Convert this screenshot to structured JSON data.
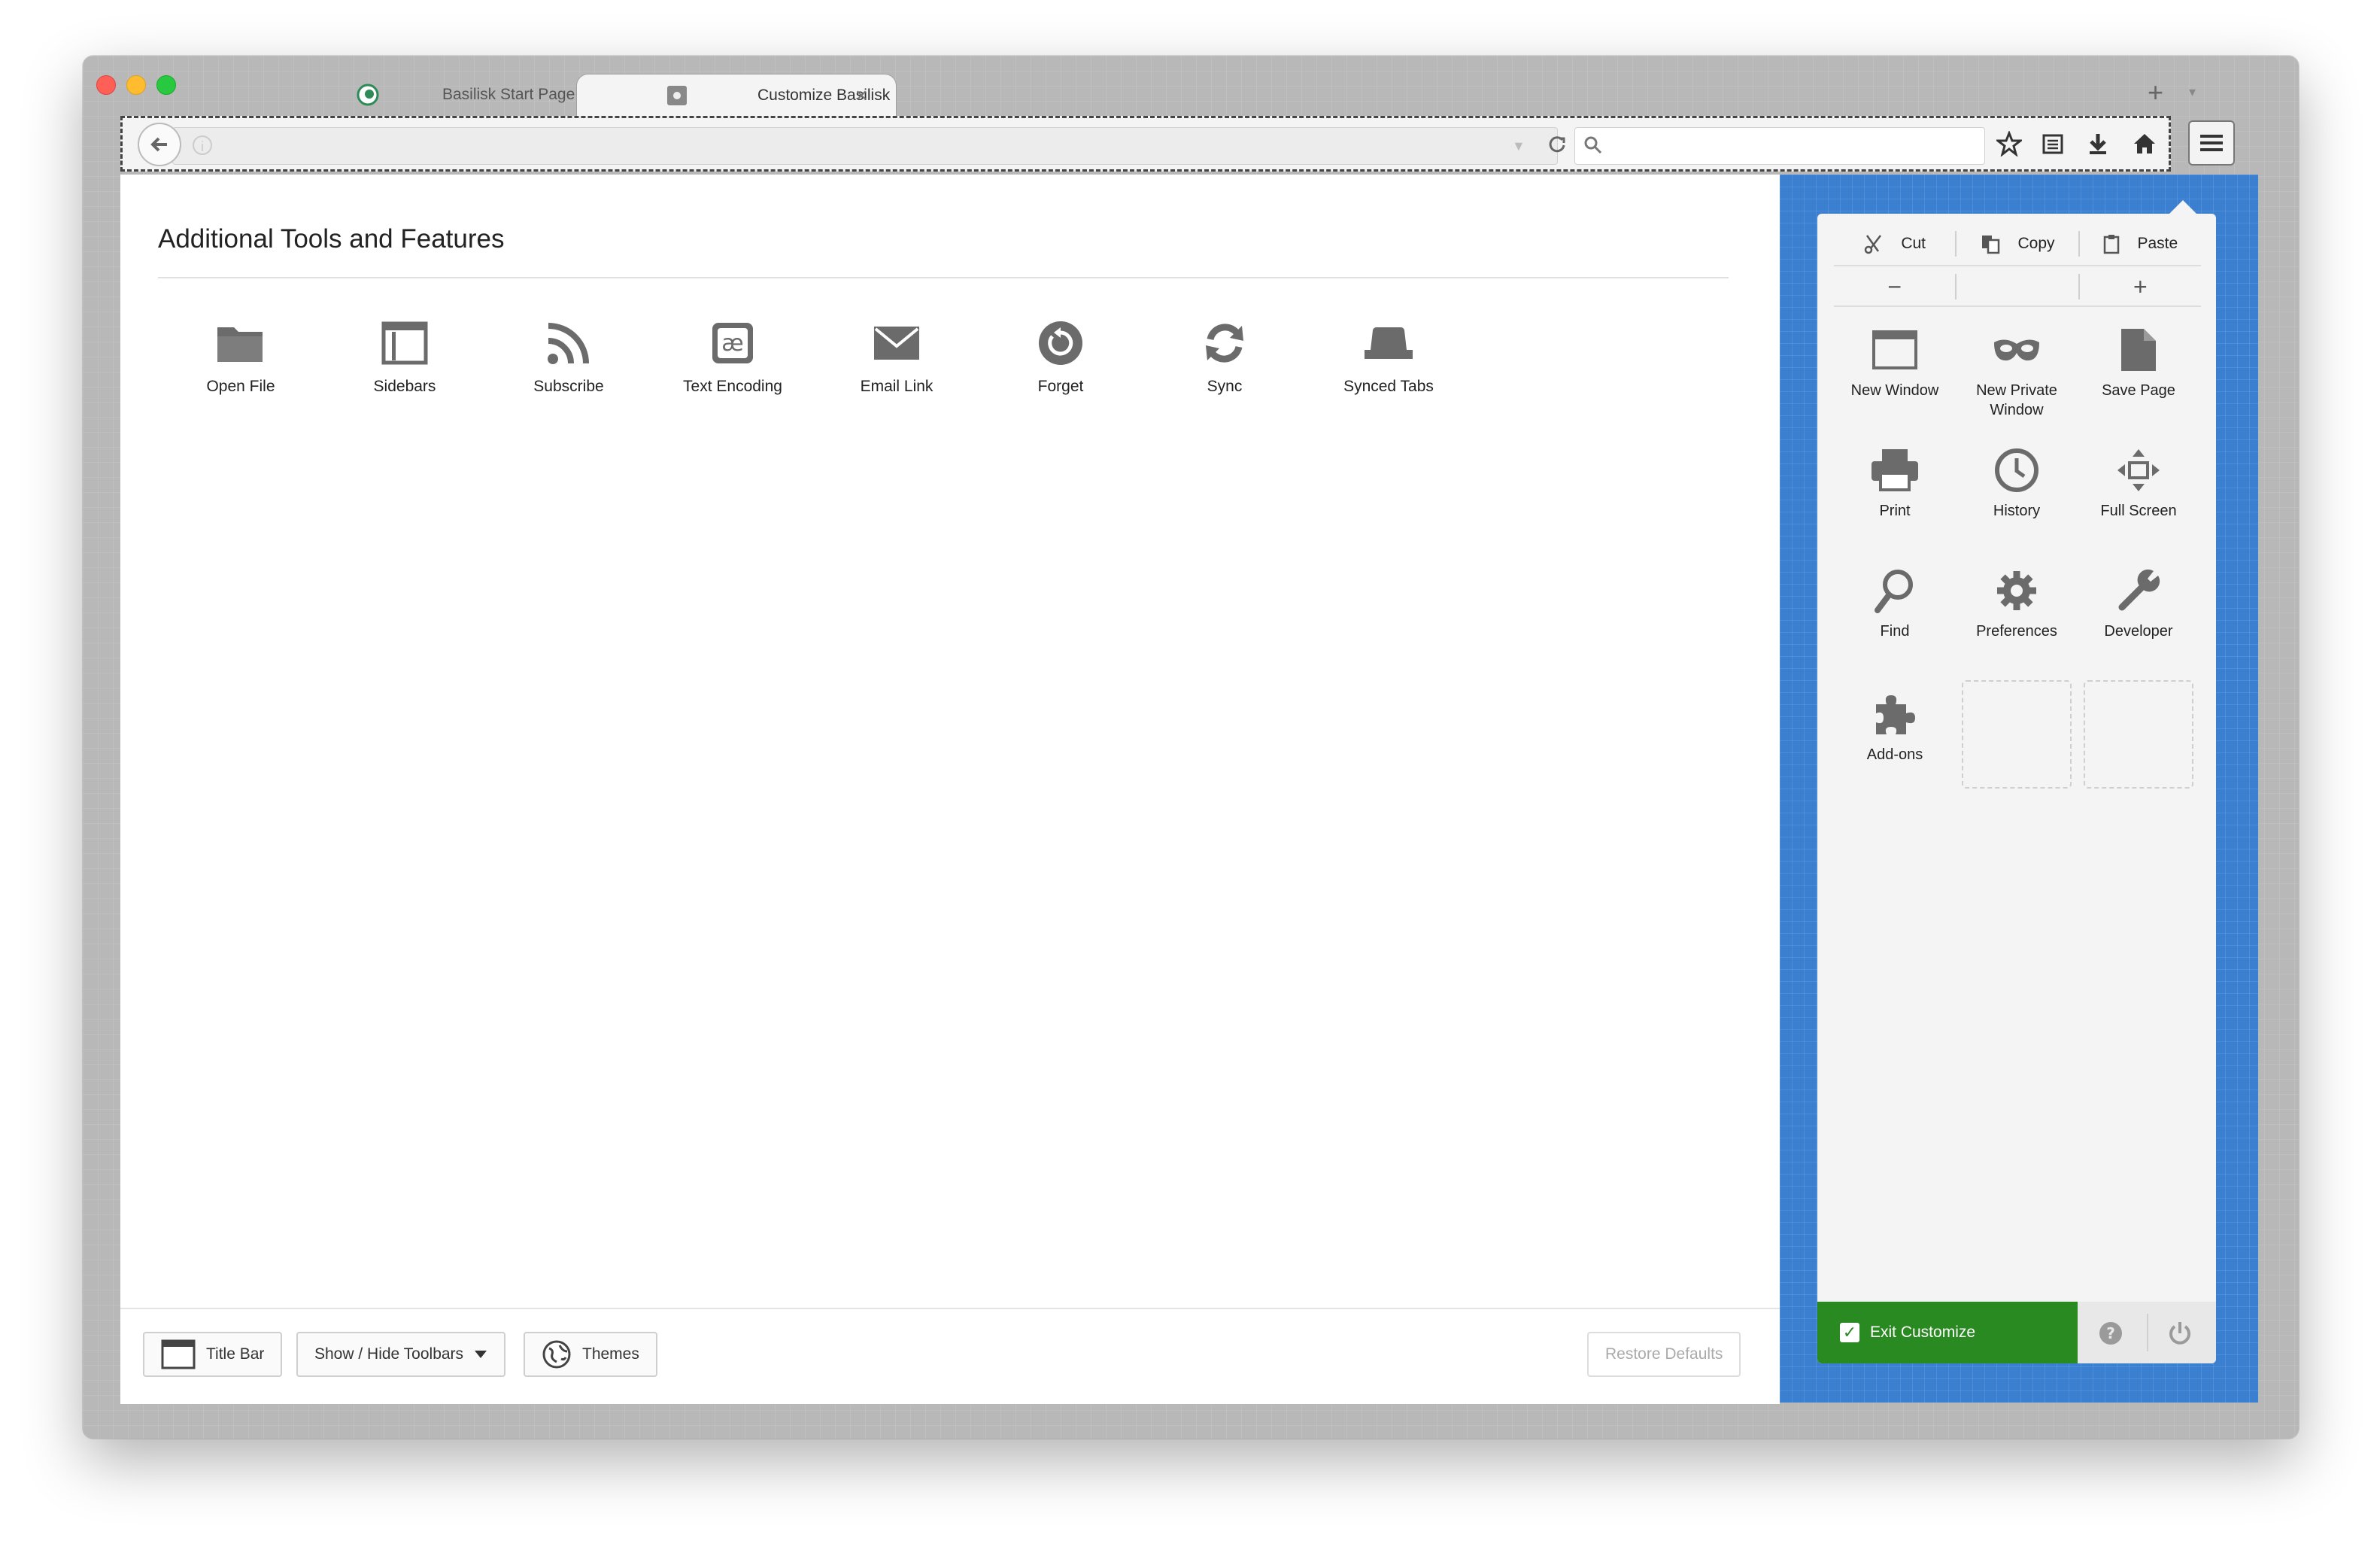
{
  "tabs": [
    {
      "title": "Basilisk Start Page",
      "icon": "basilisk-logo-icon",
      "close": "×"
    },
    {
      "title": "Customize Basilisk",
      "icon": "gear-tab-icon",
      "close": "×"
    }
  ],
  "tabstrip": {
    "new_tab": "+",
    "list_all": "▾"
  },
  "navbar": {
    "back": "back-arrow-icon",
    "reload": "reload-icon",
    "search": "search-icon"
  },
  "palette": {
    "title": "Additional Tools and Features",
    "items": [
      {
        "label": "Open File",
        "icon": "folder-icon"
      },
      {
        "label": "Sidebars",
        "icon": "sidebar-icon"
      },
      {
        "label": "Subscribe",
        "icon": "rss-icon"
      },
      {
        "label": "Text Encoding",
        "icon": "text-encoding-icon"
      },
      {
        "label": "Email Link",
        "icon": "envelope-icon"
      },
      {
        "label": "Forget",
        "icon": "forget-icon"
      },
      {
        "label": "Sync",
        "icon": "sync-icon"
      },
      {
        "label": "Synced Tabs",
        "icon": "synced-tabs-icon"
      }
    ]
  },
  "footer": {
    "title_bar": "Title Bar",
    "toolbars": "Show / Hide Toolbars",
    "themes": "Themes",
    "restore": "Restore Defaults"
  },
  "panel": {
    "edit": {
      "cut": "Cut",
      "copy": "Copy",
      "paste": "Paste"
    },
    "zoom": {
      "out": "−",
      "in": "+"
    },
    "items": [
      {
        "label": "New Window",
        "icon": "window-icon"
      },
      {
        "label": "New Private Window",
        "icon": "mask-icon"
      },
      {
        "label": "Save Page",
        "icon": "page-icon"
      },
      {
        "label": "Print",
        "icon": "printer-icon"
      },
      {
        "label": "History",
        "icon": "clock-icon"
      },
      {
        "label": "Full Screen",
        "icon": "fullscreen-icon"
      },
      {
        "label": "Find",
        "icon": "magnifier-icon"
      },
      {
        "label": "Preferences",
        "icon": "gear-icon"
      },
      {
        "label": "Developer",
        "icon": "wrench-icon"
      },
      {
        "label": "Add-ons",
        "icon": "puzzle-icon"
      }
    ],
    "exit": "Exit Customize",
    "check": "✓"
  }
}
